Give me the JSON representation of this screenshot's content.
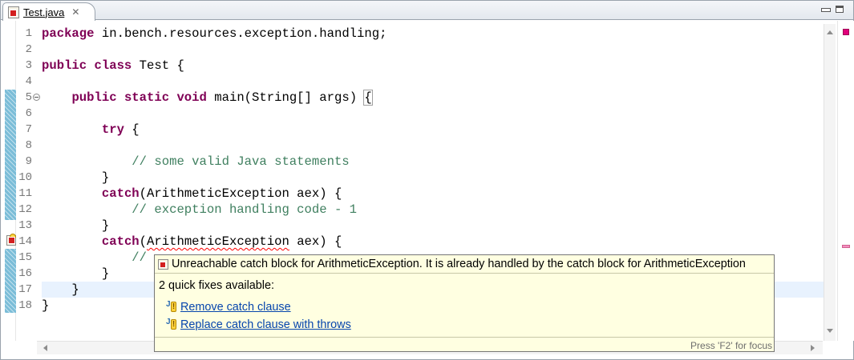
{
  "tab": {
    "file_name": "Test.java",
    "close_glyph": "✕"
  },
  "editor": {
    "line_numbers": [
      "1",
      "2",
      "3",
      "4",
      "5",
      "6",
      "7",
      "8",
      "9",
      "10",
      "11",
      "12",
      "13",
      "14",
      "15",
      "16",
      "17",
      "18"
    ],
    "folded_line": "5",
    "current_line": "17",
    "error_line": "14"
  },
  "code": {
    "l1_kw": "package",
    "l1_rest": " in.bench.resources.exception.handling;",
    "l3_kw": "public class",
    "l3_rest": " Test {",
    "l5_indent": "    ",
    "l5_kw": "public static void",
    "l5_rest": " main(String[] args) ",
    "l5_brace": "{",
    "l7_indent": "        ",
    "l7_kw": "try",
    "l7_rest": " {",
    "l9_comment": "            // some valid Java statements",
    "l10_text": "        }",
    "l11_indent": "        ",
    "l11_kw": "catch",
    "l11_rest": "(ArithmeticException aex) {",
    "l12_comment": "            // exception handling code - 1",
    "l13_text": "        }",
    "l14_indent": "        ",
    "l14_kw": "catch",
    "l14_paren": "(",
    "l14_err": "ArithmeticException",
    "l14_rest": " aex) {",
    "l15_comment": "            //",
    "l16_text": "        }",
    "l17_text": "    }",
    "l18_text": "}"
  },
  "hover": {
    "message": "Unreachable catch block for ArithmeticException. It is already handled by the catch block for ArithmeticException",
    "fix_count": "2 quick fixes available:",
    "fixes": [
      {
        "label": "Remove catch clause"
      },
      {
        "label": "Replace catch clause with throws"
      }
    ],
    "status": "Press 'F2' for focus"
  },
  "colors": {
    "keyword": "#7f0055",
    "comment": "#3f7f5f",
    "current_line_bg": "#e8f2fe",
    "popup_bg": "#ffffe1",
    "link": "#0645ad",
    "error_overview": "#e0007a"
  },
  "icons": {
    "tab_icon": "java-file-error-icon",
    "gutter_error": "error-marker-icon",
    "fold": "fold-toggle-icon",
    "quick_fix": "quick-fix-icon"
  }
}
